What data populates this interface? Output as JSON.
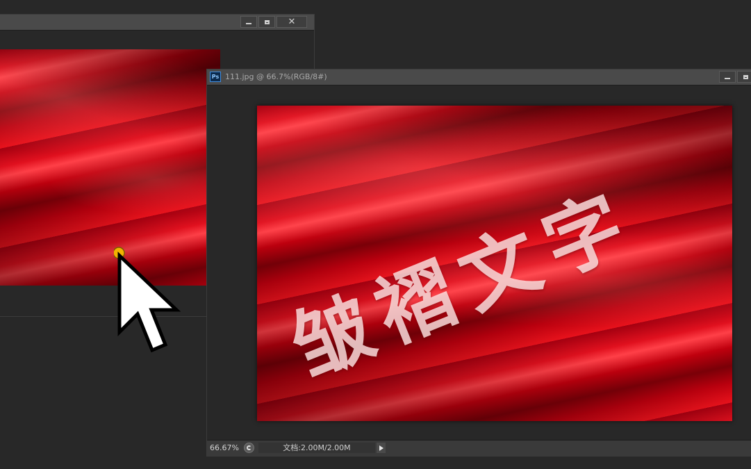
{
  "back_window": {
    "controls": {
      "minimize": "minimize",
      "maximize": "maximize",
      "close": "✕"
    }
  },
  "front_window": {
    "app_icon_label": "Ps",
    "title": "111.jpg @ 66.7%(RGB/8#)",
    "status": {
      "zoom": "66.67%",
      "doc_info": "文档:2.00M/2.00M"
    },
    "image_text": "皱褶文字"
  },
  "icons": {
    "back_min": "minimize-icon",
    "back_max": "maximize-icon",
    "back_close": "close-icon",
    "front_min": "minimize-icon",
    "front_max": "maximize-icon",
    "cursor": "arrow-cursor-icon",
    "status_menu": "play-triangle-icon"
  },
  "colors": {
    "workspace": "#282828",
    "titlebar": "#4a4a4a",
    "fabric_red": "#d40012",
    "cursor_dot": "#f2b300"
  }
}
